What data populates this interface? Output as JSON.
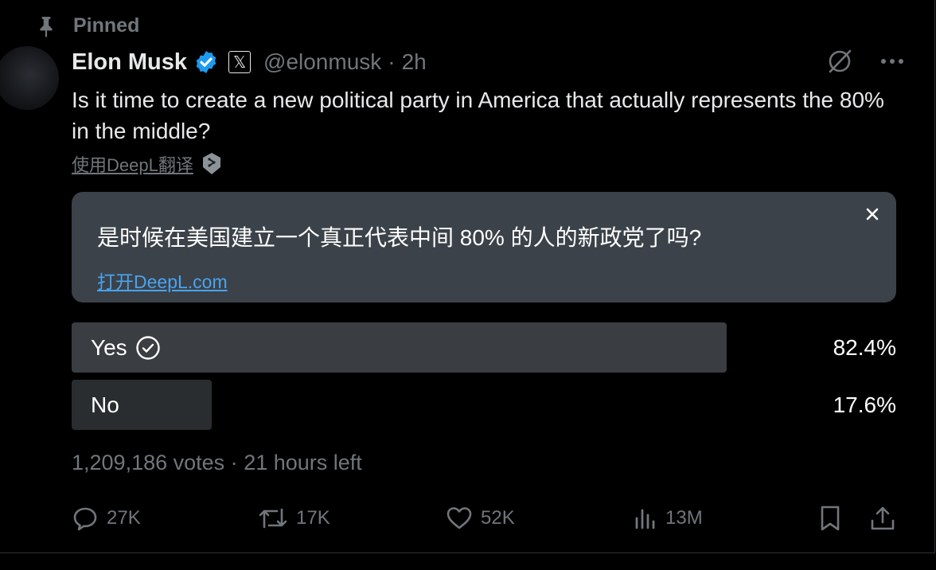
{
  "pinned": {
    "label": "Pinned",
    "icon": "pin-icon"
  },
  "author": {
    "name": "Elon Musk",
    "handle": "@elonmusk",
    "separator": "·",
    "time": "2h",
    "verified_color": "#1d9bf0"
  },
  "tweet": {
    "text": "Is it time to create a new political party in America that actually represents the 80% in the middle?",
    "translate_label": "使用DeepL翻译"
  },
  "deepl": {
    "translation": "是时候在美国建立一个真正代表中间 80% 的人的新政党了吗?",
    "open_link": "打开DeepL.com",
    "link_color": "#4aa3f0"
  },
  "poll": {
    "options": [
      {
        "label": "Yes",
        "percent": "82.4%",
        "fraction": 0.824,
        "chosen": true
      },
      {
        "label": "No",
        "percent": "17.6%",
        "fraction": 0.176,
        "chosen": false
      }
    ],
    "votes": "1,209,186 votes",
    "separator": "·",
    "time_left": "21 hours left"
  },
  "actions": {
    "replies": "27K",
    "reposts": "17K",
    "likes": "52K",
    "views": "13M"
  },
  "colors": {
    "background": "#000000",
    "text": "#e7e9ea",
    "muted": "#71767b"
  }
}
